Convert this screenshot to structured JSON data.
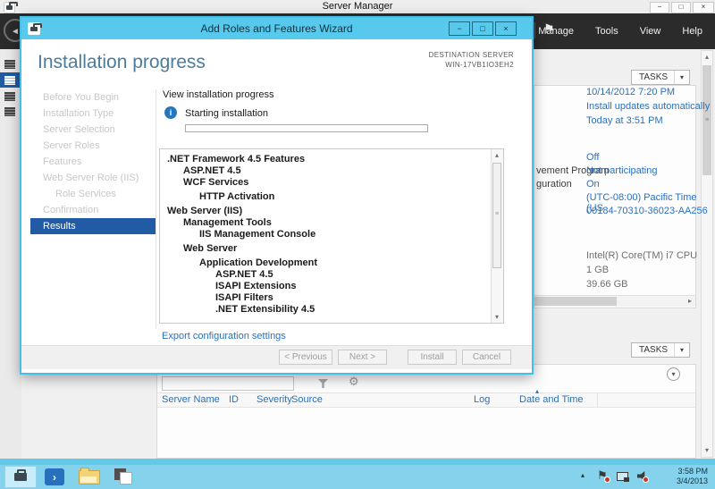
{
  "window": {
    "title": "Server Manager",
    "controls": {
      "minimize": "−",
      "maximize": "□",
      "close": "×"
    }
  },
  "header": {
    "menu_items": [
      {
        "label": "Manage"
      },
      {
        "label": "Tools"
      },
      {
        "label": "View"
      },
      {
        "label": "Help"
      }
    ]
  },
  "wizard": {
    "title": "Add Roles and Features Wizard",
    "controls": {
      "minimize": "−",
      "maximize": "□",
      "close": "×"
    },
    "heading": "Installation progress",
    "destination": {
      "label": "DESTINATION SERVER",
      "server": "WIN-17VB1IO3EH2"
    },
    "nav_items": [
      {
        "label": "Before You Begin",
        "state": "disabled"
      },
      {
        "label": "Installation Type",
        "state": "disabled"
      },
      {
        "label": "Server Selection",
        "state": "disabled"
      },
      {
        "label": "Server Roles",
        "state": "disabled"
      },
      {
        "label": "Features",
        "state": "disabled"
      },
      {
        "label": "Web Server Role (IIS)",
        "state": "disabled"
      },
      {
        "label": "Role Services",
        "state": "disabled"
      },
      {
        "label": "Confirmation",
        "state": "disabled"
      },
      {
        "label": "Results",
        "state": "selected"
      }
    ],
    "content": {
      "view_label": "View installation progress",
      "status_text": "Starting installation",
      "progress_percent": 0,
      "features": [
        {
          "label": ".NET Framework 4.5 Features",
          "level": 0
        },
        {
          "label": "ASP.NET 4.5",
          "level": 1
        },
        {
          "label": "WCF Services",
          "level": 1
        },
        {
          "label": "HTTP Activation",
          "level": 2
        },
        {
          "label": "Web Server (IIS)",
          "level": 0
        },
        {
          "label": "Management Tools",
          "level": 1
        },
        {
          "label": "IIS Management Console",
          "level": 2
        },
        {
          "label": "Web Server",
          "level": 1
        },
        {
          "label": "Application Development",
          "level": 2
        },
        {
          "label": "ASP.NET 4.5",
          "level": 3
        },
        {
          "label": "ISAPI Extensions",
          "level": 3
        },
        {
          "label": "ISAPI Filters",
          "level": 3
        },
        {
          "label": ".NET Extensibility 4.5",
          "level": 3
        }
      ],
      "export_link": "Export configuration settings"
    },
    "buttons": [
      {
        "label": "< Previous",
        "enabled": false
      },
      {
        "label": "Next >",
        "enabled": false
      },
      {
        "label": "Install",
        "enabled": false
      },
      {
        "label": "Cancel",
        "enabled": false
      }
    ]
  },
  "properties_panel": {
    "tasks_label": "TASKS",
    "label_fragments": [
      {
        "text": "vement Program"
      },
      {
        "text": "guration"
      }
    ],
    "blue_values": [
      {
        "text": "10/14/2012 7:20 PM"
      },
      {
        "text": "Install updates automatically"
      },
      {
        "text": "Today at 3:51 PM"
      },
      {
        "text": "Off"
      },
      {
        "text": "Not participating"
      },
      {
        "text": "On"
      },
      {
        "text": "(UTC-08:00) Pacific Time (US"
      },
      {
        "text": "00184-70310-36023-AA256"
      }
    ],
    "gray_values": [
      {
        "text": "Intel(R) Core(TM) i7 CPU"
      },
      {
        "text": "1 GB"
      },
      {
        "text": "39.66 GB"
      }
    ]
  },
  "events_panel": {
    "tasks_label": "TASKS",
    "columns": [
      {
        "label": "Server Name"
      },
      {
        "label": "ID"
      },
      {
        "label": "Severity"
      },
      {
        "label": "Source"
      },
      {
        "label": "Log"
      },
      {
        "label": "Date and Time"
      }
    ]
  },
  "taskbar": {
    "clock": {
      "time": "3:58 PM",
      "date": "3/4/2013"
    }
  },
  "icons": {
    "back": "◄",
    "flag": "⚑",
    "dropdown": "▾",
    "scroll_up": "▴",
    "scroll_down": "▾",
    "scroll_right": "▸",
    "grip": "≡",
    "info": "i",
    "chevron_down": "▾",
    "sort_asc": "▴",
    "gear": "⚙",
    "tray_expand": "▴",
    "powershell": "›"
  }
}
